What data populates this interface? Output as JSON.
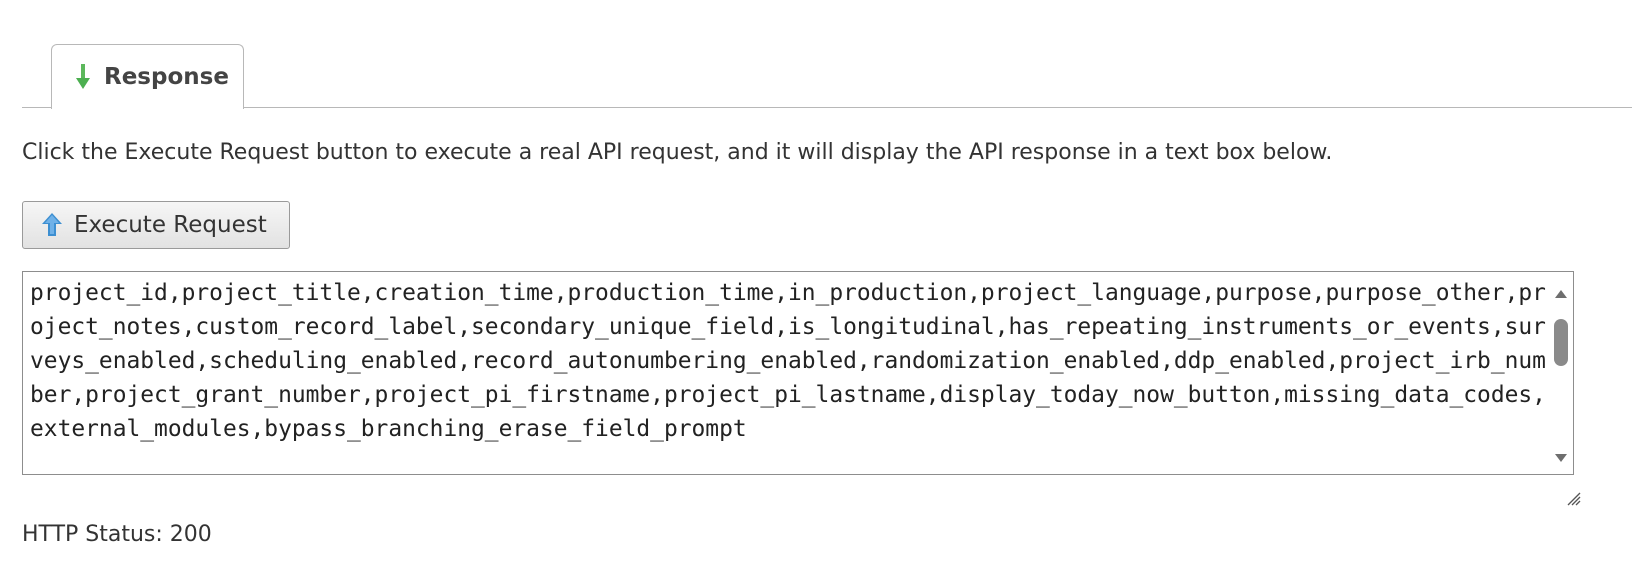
{
  "tab": {
    "label": "Response",
    "icon": "arrow-down-icon",
    "icon_color": "#4caf50"
  },
  "instructions": "Click the Execute Request button to execute a real API request, and it will display the API response in a text box below.",
  "execute_button": {
    "label": "Execute Request",
    "icon": "arrow-up-icon",
    "icon_color": "#3d8fd1"
  },
  "response_text": "project_id,project_title,creation_time,production_time,in_production,project_language,purpose,purpose_other,project_notes,custom_record_label,secondary_unique_field,is_longitudinal,has_repeating_instruments_or_events,surveys_enabled,scheduling_enabled,record_autonumbering_enabled,randomization_enabled,ddp_enabled,project_irb_number,project_grant_number,project_pi_firstname,project_pi_lastname,display_today_now_button,missing_data_codes,external_modules,bypass_branching_erase_field_prompt",
  "status": "HTTP Status: 200"
}
